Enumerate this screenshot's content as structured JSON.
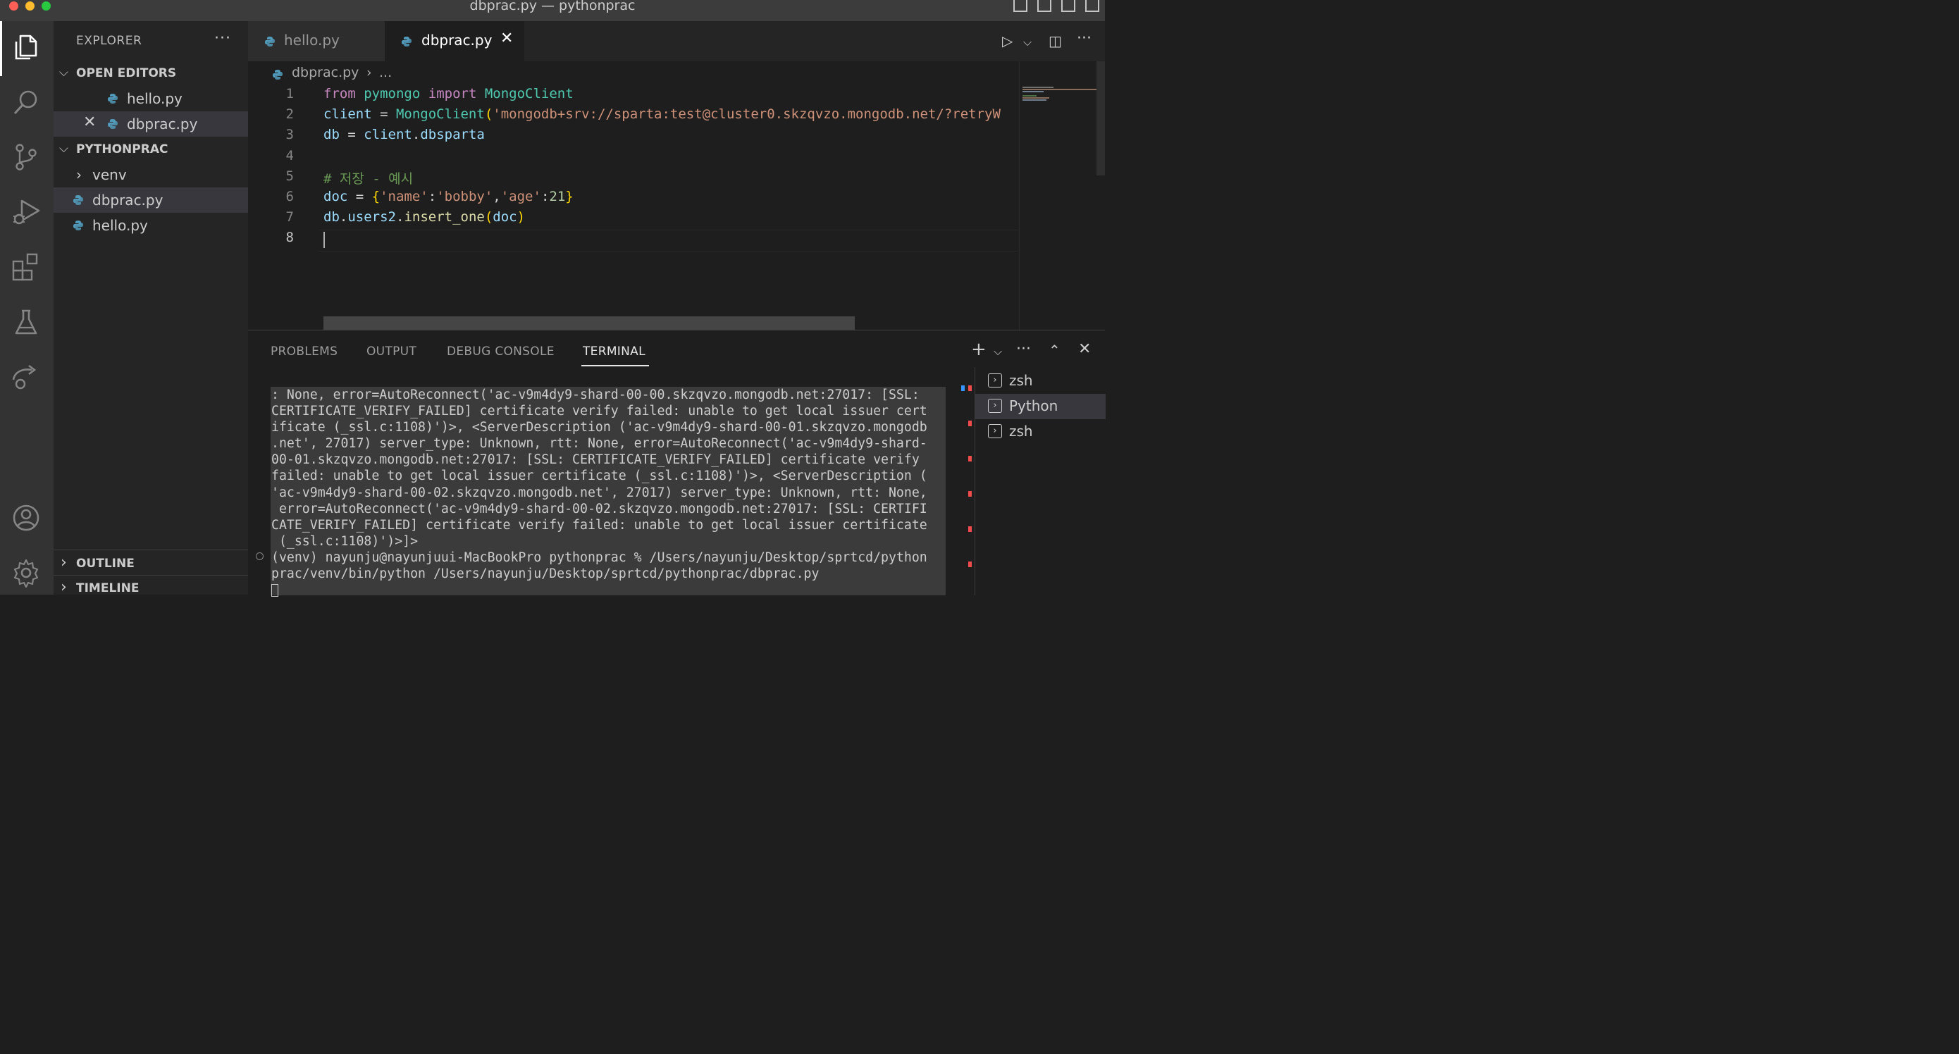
{
  "window": {
    "title": "dbprac.py — pythonprac"
  },
  "sidebar": {
    "header": "EXPLORER",
    "open_editors": {
      "title": "OPEN EDITORS",
      "items": [
        {
          "label": "hello.py"
        },
        {
          "label": "dbprac.py"
        }
      ]
    },
    "folder": {
      "title": "PYTHONPRAC",
      "items": [
        {
          "label": "venv"
        },
        {
          "label": "dbprac.py"
        },
        {
          "label": "hello.py"
        }
      ]
    },
    "outline": "OUTLINE",
    "timeline": "TIMELINE"
  },
  "tabs": [
    {
      "label": "hello.py"
    },
    {
      "label": "dbprac.py"
    }
  ],
  "breadcrumb": {
    "file": "dbprac.py",
    "rest": "..."
  },
  "editor": {
    "line_numbers": [
      "1",
      "2",
      "3",
      "4",
      "5",
      "6",
      "7",
      "8"
    ],
    "lines": [
      [
        {
          "t": "from",
          "c": "kw"
        },
        {
          "t": " "
        },
        {
          "t": "pymongo",
          "c": "cls"
        },
        {
          "t": " "
        },
        {
          "t": "import",
          "c": "kw"
        },
        {
          "t": " "
        },
        {
          "t": "MongoClient",
          "c": "cls"
        }
      ],
      [
        {
          "t": "client",
          "c": "var"
        },
        {
          "t": " = ",
          "c": "op"
        },
        {
          "t": "MongoClient",
          "c": "cls"
        },
        {
          "t": "(",
          "c": "br1"
        },
        {
          "t": "'mongodb+srv://sparta:test@cluster0.skzqvzo.mongodb.net/?retryW",
          "c": "str"
        }
      ],
      [
        {
          "t": "db",
          "c": "var"
        },
        {
          "t": " = ",
          "c": "op"
        },
        {
          "t": "client",
          "c": "var"
        },
        {
          "t": ".",
          "c": "op"
        },
        {
          "t": "dbsparta",
          "c": "var"
        }
      ],
      [],
      [
        {
          "t": "# 저장 - 예시",
          "c": "cmt"
        }
      ],
      [
        {
          "t": "doc",
          "c": "var"
        },
        {
          "t": " = ",
          "c": "op"
        },
        {
          "t": "{",
          "c": "br1"
        },
        {
          "t": "'name'",
          "c": "str"
        },
        {
          "t": ":",
          "c": "op"
        },
        {
          "t": "'bobby'",
          "c": "str"
        },
        {
          "t": ",",
          "c": "op"
        },
        {
          "t": "'age'",
          "c": "str"
        },
        {
          "t": ":",
          "c": "op"
        },
        {
          "t": "21",
          "c": "num"
        },
        {
          "t": "}",
          "c": "br1"
        }
      ],
      [
        {
          "t": "db",
          "c": "var"
        },
        {
          "t": ".",
          "c": "op"
        },
        {
          "t": "users2",
          "c": "var"
        },
        {
          "t": ".",
          "c": "op"
        },
        {
          "t": "insert_one",
          "c": "fn"
        },
        {
          "t": "(",
          "c": "br1"
        },
        {
          "t": "doc",
          "c": "var"
        },
        {
          "t": ")",
          "c": "br1"
        }
      ],
      []
    ]
  },
  "panel": {
    "tabs": [
      {
        "label": "PROBLEMS"
      },
      {
        "label": "OUTPUT"
      },
      {
        "label": "DEBUG CONSOLE"
      },
      {
        "label": "TERMINAL"
      }
    ],
    "active_tab": "TERMINAL",
    "terminal_lines": [
      ": None, error=AutoReconnect('ac-v9m4dy9-shard-00-00.skzqvzo.mongodb.net:27017: [SSL:",
      "CERTIFICATE_VERIFY_FAILED] certificate verify failed: unable to get local issuer cert",
      "ificate (_ssl.c:1108)')>, <ServerDescription ('ac-v9m4dy9-shard-00-01.skzqvzo.mongodb",
      ".net', 27017) server_type: Unknown, rtt: None, error=AutoReconnect('ac-v9m4dy9-shard-",
      "00-01.skzqvzo.mongodb.net:27017: [SSL: CERTIFICATE_VERIFY_FAILED] certificate verify",
      "failed: unable to get local issuer certificate (_ssl.c:1108)')>, <ServerDescription (",
      "'ac-v9m4dy9-shard-00-02.skzqvzo.mongodb.net', 27017) server_type: Unknown, rtt: None,",
      " error=AutoReconnect('ac-v9m4dy9-shard-00-02.skzqvzo.mongodb.net:27017: [SSL: CERTIFI",
      "CATE_VERIFY_FAILED] certificate verify failed: unable to get local issuer certificate",
      " (_ssl.c:1108)')>]>",
      "(venv) nayunju@nayunjuui-MacBookPro pythonprac % /Users/nayunju/Desktop/sprtcd/python",
      "prac/venv/bin/python /Users/nayunju/Desktop/sprtcd/pythonprac/dbprac.py"
    ],
    "terminal_list": [
      {
        "label": "zsh"
      },
      {
        "label": "Python"
      },
      {
        "label": "zsh"
      }
    ]
  },
  "colors": {
    "accent": "#007acc",
    "python_icon": "#519aba",
    "error_mark": "#f14c4c"
  }
}
